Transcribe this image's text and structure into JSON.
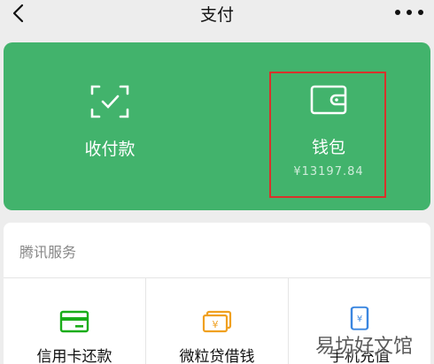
{
  "nav": {
    "title": "支付",
    "back_icon": "chevron-left-icon",
    "more_icon": "more-dots-icon"
  },
  "card": {
    "pay": {
      "label": "收付款",
      "icon": "scan-check-icon"
    },
    "wallet": {
      "label": "钱包",
      "balance": "¥13197.84",
      "icon": "wallet-icon"
    }
  },
  "services": {
    "title": "腾讯服务",
    "items": [
      {
        "label": "信用卡还款",
        "icon": "credit-card-icon",
        "color": "#1aad19"
      },
      {
        "label": "微粒贷借钱",
        "icon": "cash-stack-icon",
        "color": "#f0a020"
      },
      {
        "label": "手机充值",
        "icon": "phone-recharge-icon",
        "color": "#3a86e0"
      }
    ]
  },
  "watermark": "易坊好文馆",
  "colors": {
    "card_green": "#42b36c",
    "highlight_red": "#d8322b"
  }
}
